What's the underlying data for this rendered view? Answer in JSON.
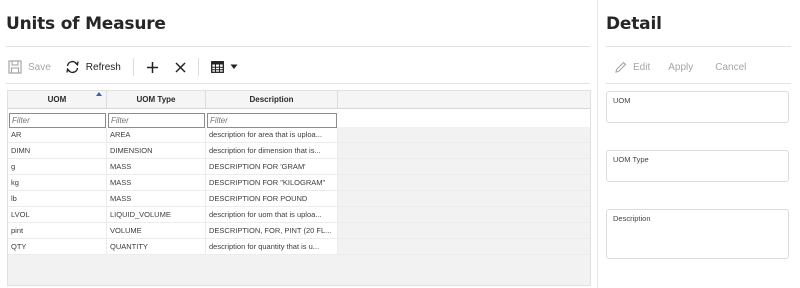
{
  "header": {
    "title": "Units of Measure"
  },
  "toolbar": {
    "save_label": "Save",
    "refresh_label": "Refresh"
  },
  "grid": {
    "columns": [
      "UOM",
      "UOM Type",
      "Description"
    ],
    "filter_placeholder": "Filter",
    "sort_column": "UOM",
    "rows": [
      [
        "AR",
        "AREA",
        "description for area that is uploa..."
      ],
      [
        "DIMN",
        "DIMENSION",
        "description for dimension that is..."
      ],
      [
        "g",
        "MASS",
        "DESCRIPTION FOR 'GRAM'"
      ],
      [
        "kg",
        "MASS",
        "DESCRIPTION FOR \"KILOGRAM\""
      ],
      [
        "lb",
        "MASS",
        "DESCRIPTION FOR POUND"
      ],
      [
        "LVOL",
        "LIQUID_VOLUME",
        "description for uom that is uploa..."
      ],
      [
        "pint",
        "VOLUME",
        "DESCRIPTION, FOR, PINT (20 FL..."
      ],
      [
        "QTY",
        "QUANTITY",
        "description for quantity that is u..."
      ]
    ]
  },
  "detail": {
    "title": "Detail",
    "edit_label": "Edit",
    "apply_label": "Apply",
    "cancel_label": "Cancel",
    "fields": {
      "uom_label": "UOM",
      "uom_type_label": "UOM Type",
      "description_label": "Description"
    }
  },
  "colors": {
    "accent": "#2a66b5",
    "disabled": "#a6a6a6"
  }
}
